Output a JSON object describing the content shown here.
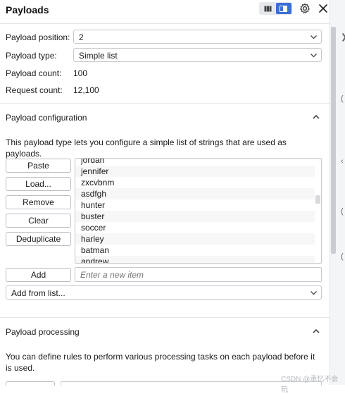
{
  "header": {
    "title": "Payloads"
  },
  "settings": {
    "position_label": "Payload position:",
    "position_value": "2",
    "type_label": "Payload type:",
    "type_value": "Simple list",
    "count_label": "Payload count:",
    "count_value": "100",
    "request_label": "Request count:",
    "request_value": "12,100"
  },
  "config": {
    "title": "Payload configuration",
    "description": "This payload type lets you configure a simple list of strings that are used as payloads.",
    "buttons": [
      "Paste",
      "Load...",
      "Remove",
      "Clear",
      "Deduplicate"
    ],
    "items": [
      "jordan",
      "jennifer",
      "zxcvbnm",
      "asdfgh",
      "hunter",
      "buster",
      "soccer",
      "harley",
      "batman",
      "andrew"
    ],
    "add_label": "Add",
    "add_placeholder": "Enter a new item",
    "add_from_list": "Add from list..."
  },
  "processing": {
    "title": "Payload processing",
    "description": "You can define rules to perform various processing tasks on each payload before it is used."
  },
  "watermark": "CSDN @承忆不会玩",
  "colors": {
    "accent": "#3b6fd8",
    "border": "#c5c8cd",
    "divider": "#e4e6ea"
  }
}
